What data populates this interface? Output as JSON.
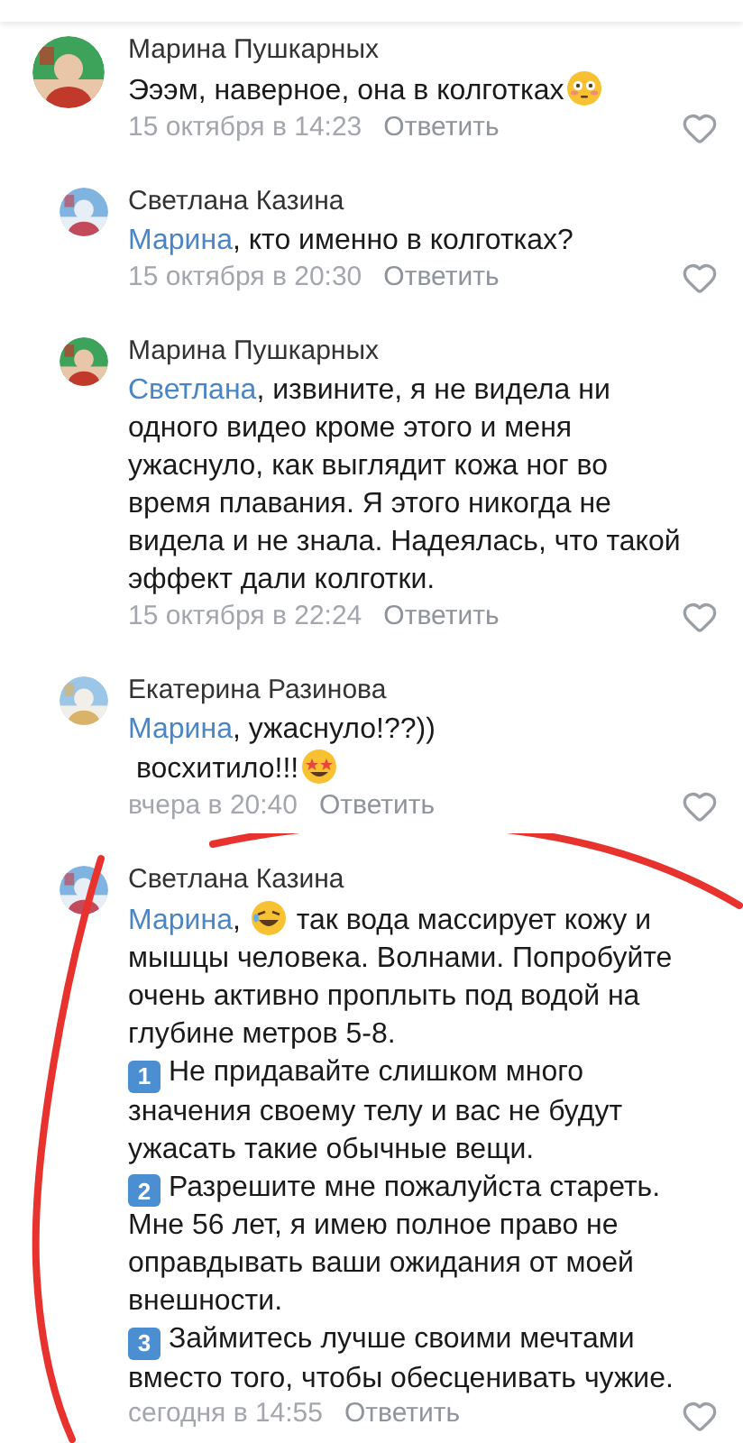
{
  "comments": [
    {
      "author": "Марина Пушкарных",
      "reply": false,
      "lines": [
        [
          {
            "kind": "text",
            "text": "Эээм, наверное, она в колготках"
          },
          {
            "kind": "flushed"
          }
        ]
      ],
      "time": "15 октября в 14:23",
      "reply_link": "Ответить"
    },
    {
      "author": "Светлана Казина",
      "reply": true,
      "lines": [
        [
          {
            "kind": "mention",
            "text": "Марина"
          },
          {
            "kind": "text",
            "text": ", кто именно в колготках?"
          }
        ]
      ],
      "time": "15 октября в 20:30",
      "reply_link": "Ответить"
    },
    {
      "author": "Марина Пушкарных",
      "reply": true,
      "lines": [
        [
          {
            "kind": "mention",
            "text": "Светлана"
          },
          {
            "kind": "text",
            "text": ", извините, я не видела ни одного видео кроме этого и меня ужаснуло, как выглядит кожа ног во время плавания. Я этого никогда не видела и не знала. Надеялась, что такой эффект дали колготки."
          }
        ]
      ],
      "time": "15 октября в 22:24",
      "reply_link": "Ответить"
    },
    {
      "author": "Екатерина Разинова",
      "reply": true,
      "lines": [
        [
          {
            "kind": "mention",
            "text": "Марина"
          },
          {
            "kind": "text",
            "text": ", ужаснуло!??))"
          }
        ],
        [
          {
            "kind": "text",
            "text": " восхитило!!!"
          },
          {
            "kind": "starstruck"
          }
        ]
      ],
      "time": "вчера в 20:40",
      "reply_link": "Ответить"
    },
    {
      "author": "Светлана Казина",
      "reply": true,
      "lines": [
        [
          {
            "kind": "mention",
            "text": "Марина"
          },
          {
            "kind": "text",
            "text": ", "
          },
          {
            "kind": "laughing"
          },
          {
            "kind": "text",
            "text": " так вода массирует кожу и мышцы человека. Волнами. Попробуйте очень активно проплыть под водой на глубине метров 5-8."
          }
        ],
        [
          {
            "kind": "keycap",
            "text": "1"
          },
          {
            "kind": "text",
            "text": " Не придавайте слишком много значения своему телу и вас не будут ужасать такие обычные вещи."
          }
        ],
        [
          {
            "kind": "keycap",
            "text": "2"
          },
          {
            "kind": "text",
            "text": " Разрешите мне пожалуйста стареть. Мне 56 лет, я имею полное право не оправдывать ваши ожидания от моей внешности."
          }
        ],
        [
          {
            "kind": "keycap",
            "text": "3"
          },
          {
            "kind": "text",
            "text": " Займитесь лучше своими мечтами вместо того, чтобы обесценивать чужие."
          }
        ]
      ],
      "time": "сегодня в 14:55",
      "reply_link": "Ответить"
    }
  ]
}
